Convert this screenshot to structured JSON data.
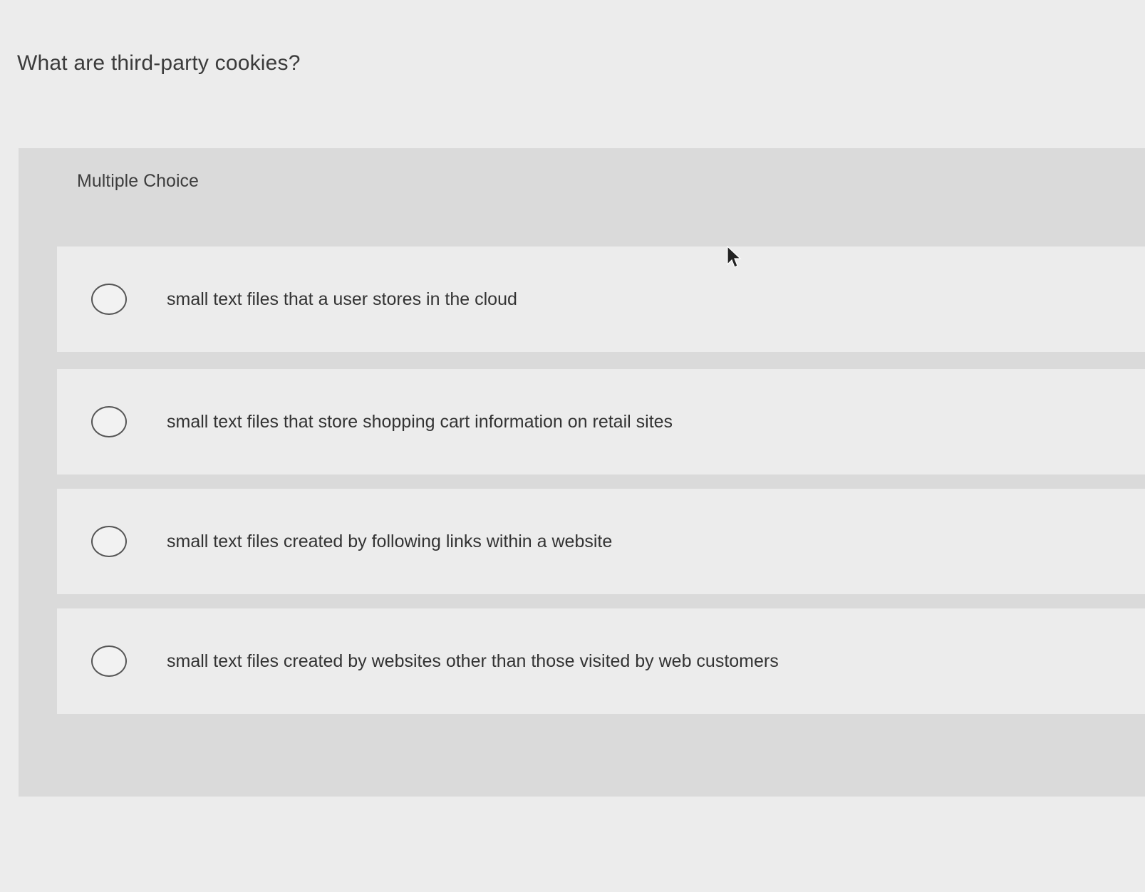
{
  "question": {
    "title": "What are third-party cookies?"
  },
  "panel": {
    "type_label": "Multiple Choice"
  },
  "options": [
    {
      "label": "small text files that a user stores in the cloud",
      "selected": false
    },
    {
      "label": "small text files that store shopping cart information on retail sites",
      "selected": false
    },
    {
      "label": "small text files created by following links within a website",
      "selected": false
    },
    {
      "label": "small text files created by websites other than those visited by web customers",
      "selected": false
    }
  ],
  "icons": {
    "radio": "radio-unselected-icon",
    "cursor": "mouse-pointer-icon"
  }
}
